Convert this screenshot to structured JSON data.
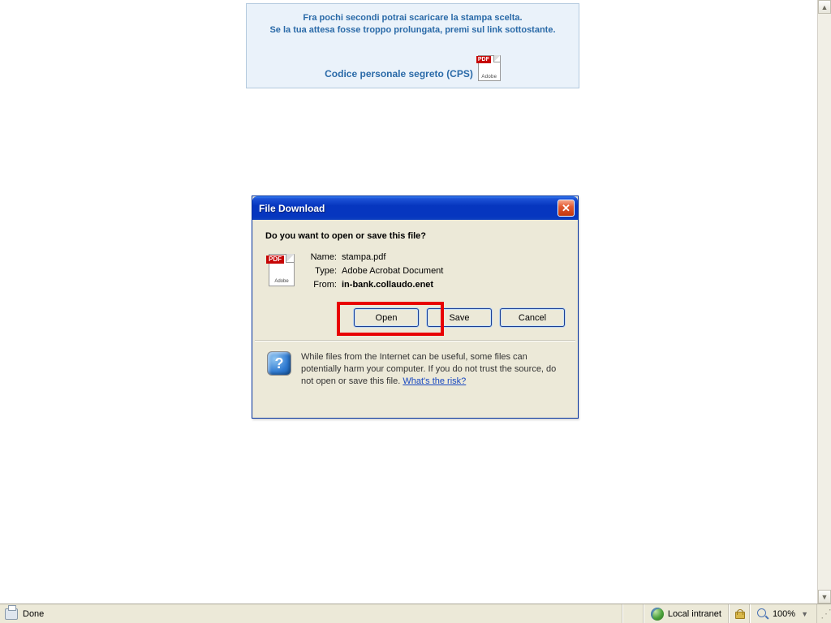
{
  "info": {
    "line1": "Fra pochi secondi potrai scaricare la stampa scelta.",
    "line2": "Se la tua attesa fosse troppo prolungata, premi sul link sottostante.",
    "link_text": "Codice personale segreto (CPS)",
    "pdf_badge": "PDF",
    "pdf_brand": "Adobe"
  },
  "dialog": {
    "title": "File Download",
    "prompt": "Do you want to open or save this file?",
    "name_label": "Name:",
    "name_value": "stampa.pdf",
    "type_label": "Type:",
    "type_value": "Adobe Acrobat Document",
    "from_label": "From:",
    "from_value": "in-bank.collaudo.enet",
    "open": "Open",
    "save": "Save",
    "cancel": "Cancel",
    "warning": "While files from the Internet can be useful, some files can potentially harm your computer. If you do not trust the source, do not open or save this file. ",
    "risk_link": "What's the risk?",
    "pdf_badge": "PDF",
    "pdf_brand": "Adobe"
  },
  "statusbar": {
    "done": "Done",
    "zone": "Local intranet",
    "zoom": "100%"
  }
}
